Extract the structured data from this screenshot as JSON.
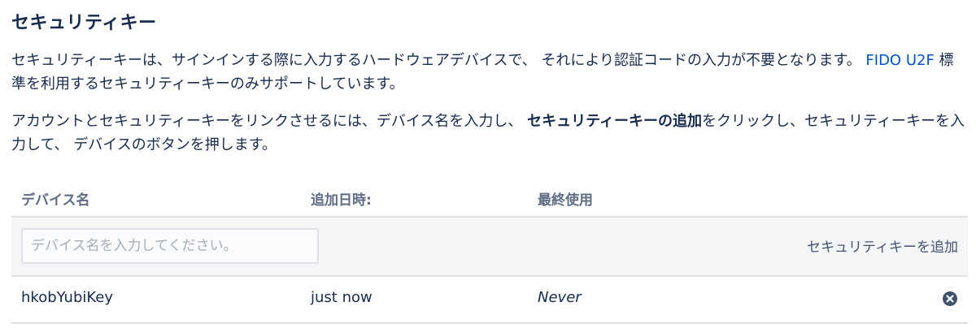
{
  "title": "セキュリティキー",
  "description1": {
    "before_link": "セキュリティーキーは、サインインする際に入力するハードウェアデバイスで、 それにより認証コードの入力が不要となります。 ",
    "link": "FIDO U2F",
    "after_link": " 標準を利用するセキュリティーキーのみサポートしています。"
  },
  "description2": {
    "before_bold": "アカウントとセキュリティーキーをリンクさせるには、デバイス名を入力し、 ",
    "bold": "セキュリティーキーの追加",
    "after_bold": "をクリックし、セキュリティーキーを入力して、 デバイスのボタンを押します。"
  },
  "table": {
    "headers": [
      "デバイス名",
      "追加日時:",
      "最終使用"
    ],
    "add_row": {
      "input_placeholder": "デバイス名を入力してください。",
      "input_value": "",
      "add_button_label": "セキュリティキーを追加"
    },
    "rows": [
      {
        "device_name": "hkobYubiKey",
        "added": "just now",
        "last_used": "Never",
        "remove_icon": "remove-circle-icon"
      }
    ]
  },
  "colors": {
    "text": "#172b4d",
    "link": "#0052cc",
    "header_text": "#5e6c84",
    "row_bg": "#f4f5f7",
    "border": "#dfe1e6",
    "icon": "#42526e"
  }
}
